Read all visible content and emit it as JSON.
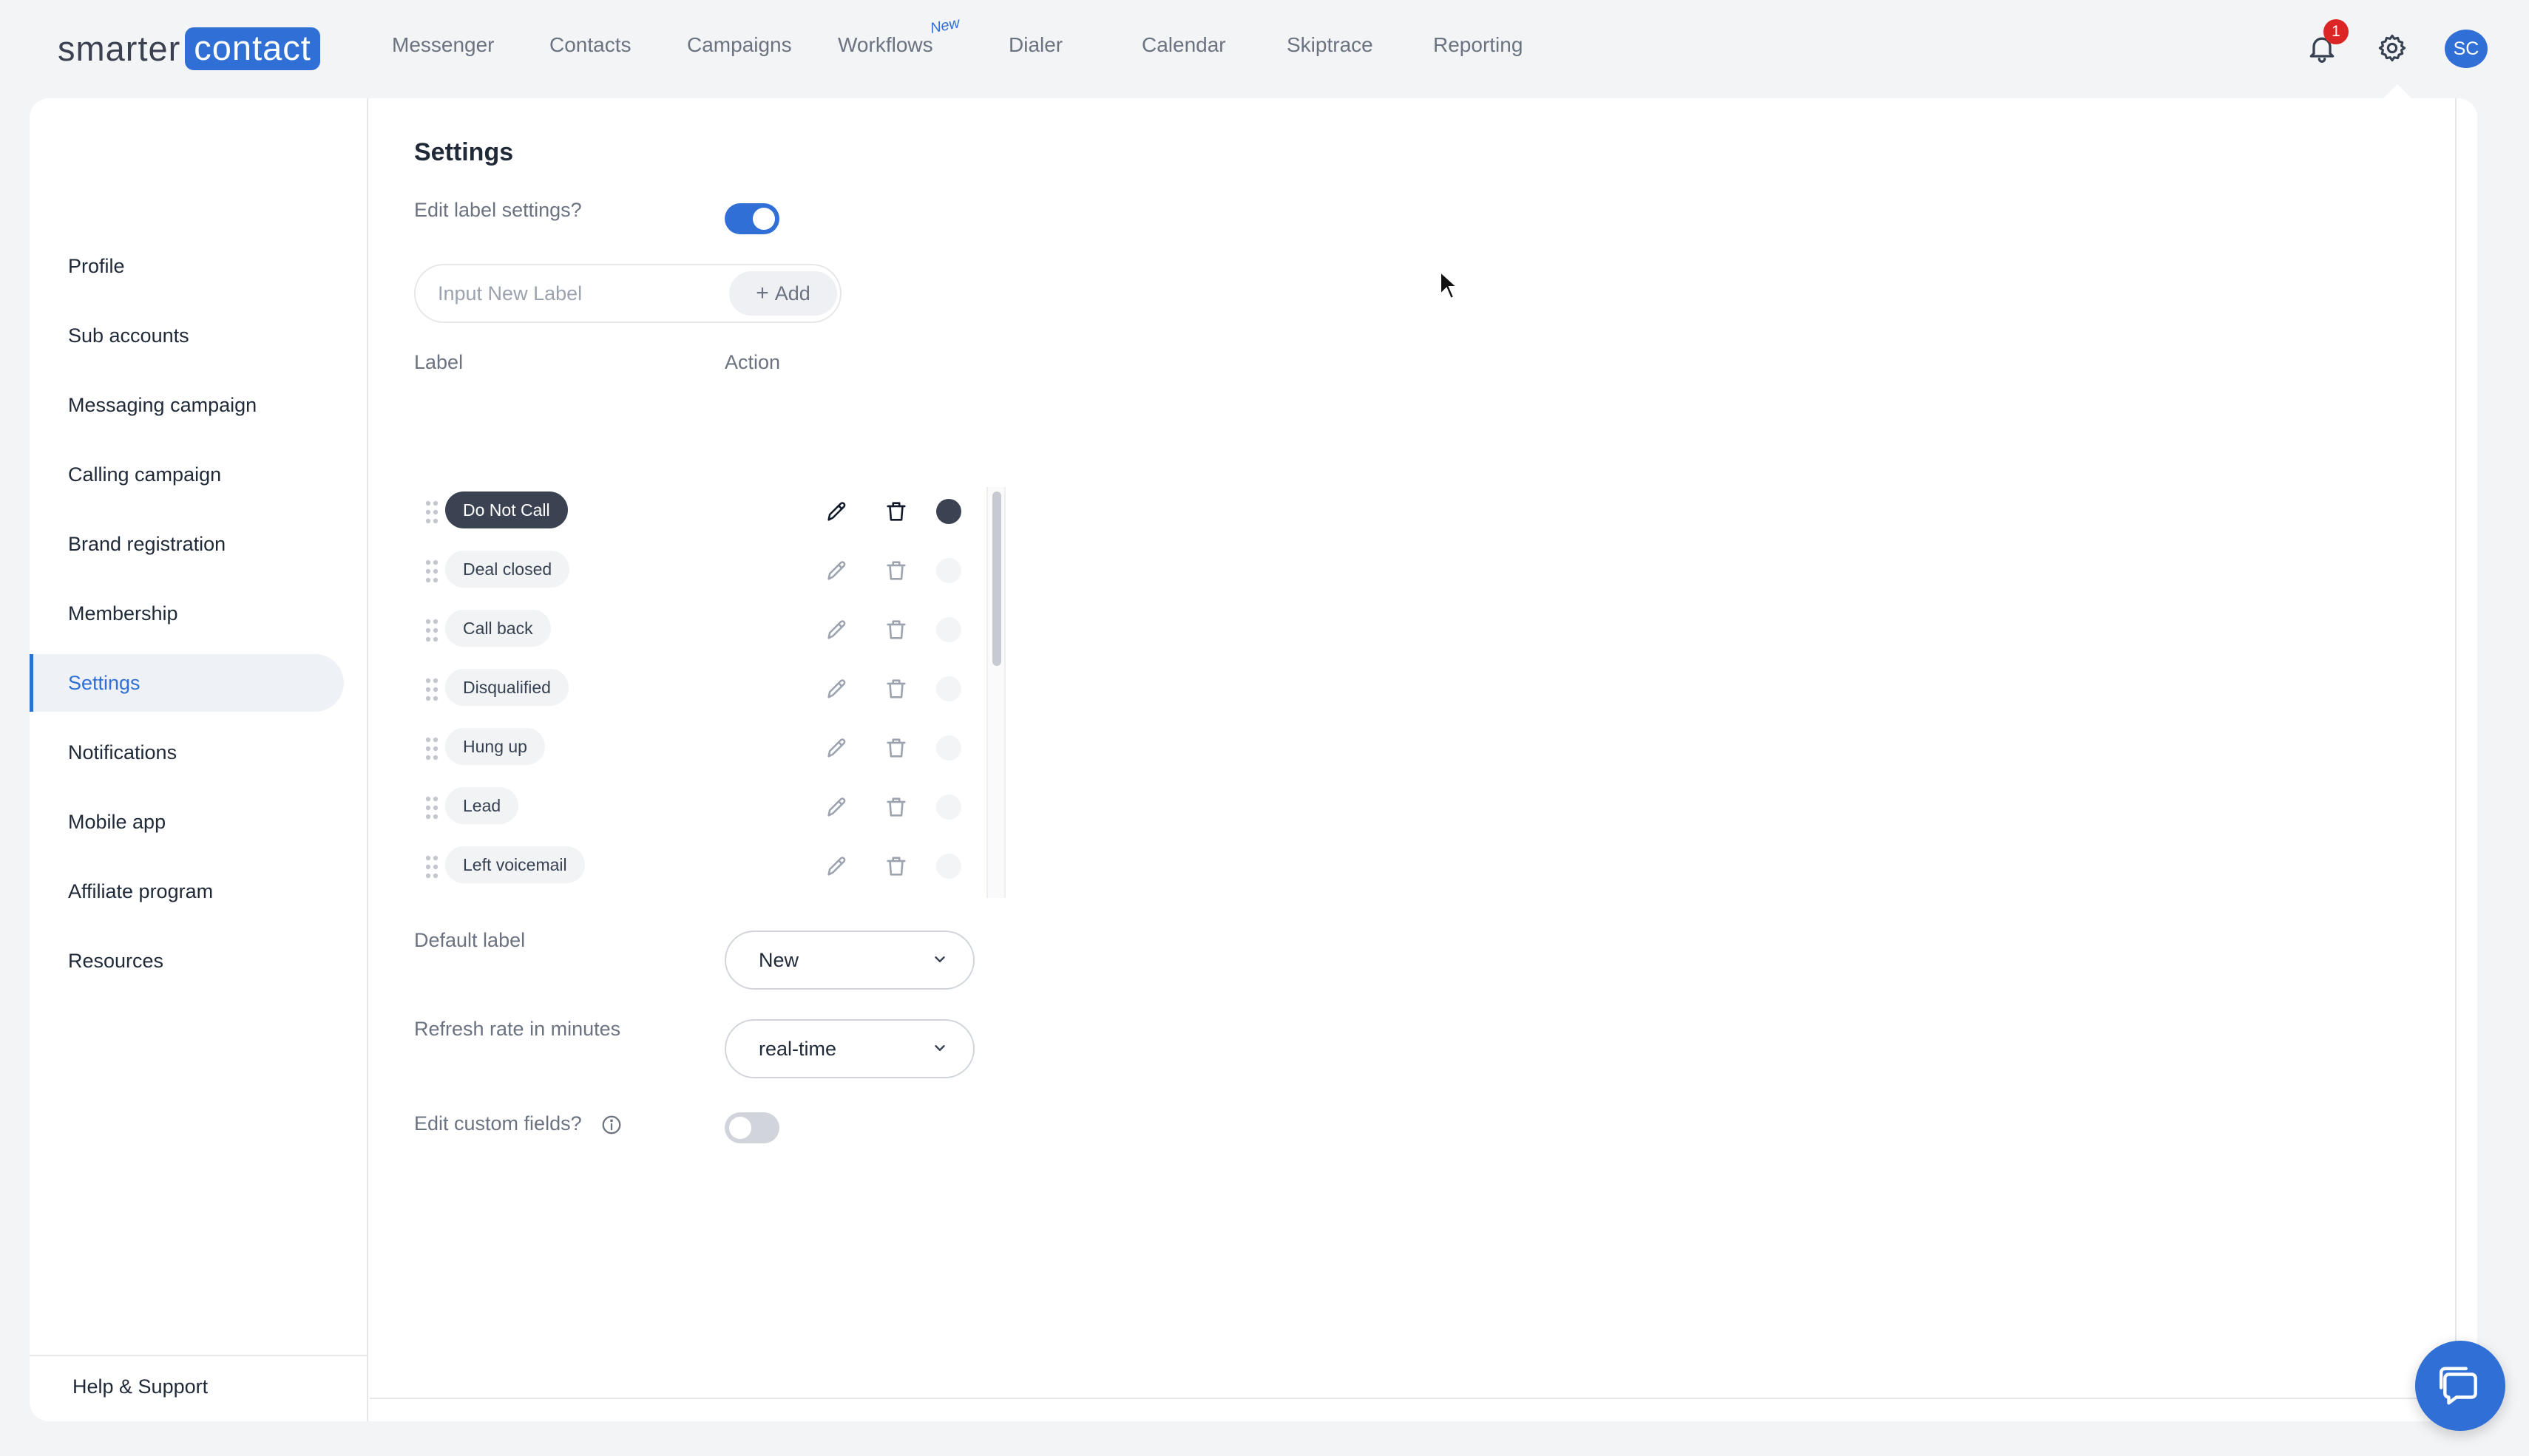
{
  "brand": {
    "logo_part1": "smarter",
    "logo_part2": "contact",
    "accent_color": "#2f6fd6"
  },
  "nav": {
    "items": [
      "Messenger",
      "Contacts",
      "Campaigns",
      "Workflows",
      "Dialer",
      "Calendar",
      "Skiptrace",
      "Reporting"
    ],
    "workflows_badge": "New"
  },
  "header": {
    "notification_count": "1",
    "avatar_initials": "SC",
    "icons": [
      "bell-icon",
      "gear-icon"
    ]
  },
  "sidebar": {
    "items": [
      "Profile",
      "Sub accounts",
      "Messaging campaign",
      "Calling campaign",
      "Brand registration",
      "Membership",
      "Settings",
      "Notifications",
      "Mobile app",
      "Affiliate program",
      "Resources"
    ],
    "active": "Settings",
    "footer": "Help & Support"
  },
  "settings": {
    "title": "Settings",
    "edit_labels_prompt": "Edit label settings?",
    "edit_labels_enabled": true,
    "new_label_placeholder": "Input New Label",
    "add_button": "Add",
    "columns": {
      "label": "Label",
      "action": "Action"
    },
    "labels": [
      {
        "name": "Do Not Call",
        "highlighted": true
      },
      {
        "name": "Deal closed",
        "highlighted": false
      },
      {
        "name": "Call back",
        "highlighted": false
      },
      {
        "name": "Disqualified",
        "highlighted": false
      },
      {
        "name": "Hung up",
        "highlighted": false
      },
      {
        "name": "Lead",
        "highlighted": false
      },
      {
        "name": "Left voicemail",
        "highlighted": false
      }
    ],
    "default_label_caption": "Default label",
    "default_label_value": "New",
    "refresh_caption": "Refresh rate in minutes",
    "refresh_value": "real-time",
    "custom_fields_prompt": "Edit custom fields?",
    "custom_fields_enabled": false
  },
  "chat": {
    "icon": "chat-icon"
  }
}
